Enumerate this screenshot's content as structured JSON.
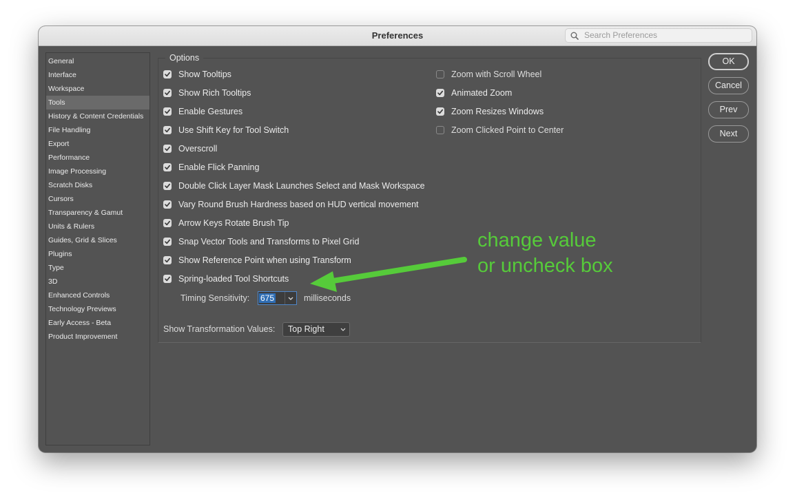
{
  "window": {
    "title": "Preferences"
  },
  "search": {
    "placeholder": "Search Preferences",
    "icon": "search-icon"
  },
  "sidebar": {
    "selected": "Tools",
    "items": [
      "General",
      "Interface",
      "Workspace",
      "Tools",
      "History & Content Credentials",
      "File Handling",
      "Export",
      "Performance",
      "Image Processing",
      "Scratch Disks",
      "Cursors",
      "Transparency & Gamut",
      "Units & Rulers",
      "Guides, Grid & Slices",
      "Plugins",
      "Type",
      "3D",
      "Enhanced Controls",
      "Technology Previews",
      "Early Access - Beta",
      "Product Improvement"
    ]
  },
  "options": {
    "legend": "Options",
    "left": [
      {
        "label": "Show Tooltips",
        "checked": true
      },
      {
        "label": "Show Rich Tooltips",
        "checked": true
      },
      {
        "label": "Enable Gestures",
        "checked": true
      },
      {
        "label": "Use Shift Key for Tool Switch",
        "checked": true
      },
      {
        "label": "Overscroll",
        "checked": true
      },
      {
        "label": "Enable Flick Panning",
        "checked": true
      },
      {
        "label": "Double Click Layer Mask Launches Select and Mask Workspace",
        "checked": true
      },
      {
        "label": "Vary Round Brush Hardness based on HUD vertical movement",
        "checked": true
      },
      {
        "label": "Arrow Keys Rotate Brush Tip",
        "checked": true
      },
      {
        "label": "Snap Vector Tools and Transforms to Pixel Grid",
        "checked": true
      },
      {
        "label": "Show Reference Point when using Transform",
        "checked": true
      },
      {
        "label": "Spring-loaded Tool Shortcuts",
        "checked": true
      }
    ],
    "right": [
      {
        "label": "Zoom with Scroll Wheel",
        "checked": false
      },
      {
        "label": "Animated Zoom",
        "checked": true
      },
      {
        "label": "Zoom Resizes Windows",
        "checked": true
      },
      {
        "label": "Zoom Clicked Point to Center",
        "checked": false
      }
    ],
    "timing": {
      "label": "Timing Sensitivity:",
      "value": "675",
      "unit": "milliseconds"
    },
    "transform_values": {
      "label": "Show Transformation Values:",
      "value": "Top Right"
    }
  },
  "buttons": {
    "ok": "OK",
    "cancel": "Cancel",
    "prev": "Prev",
    "next": "Next"
  },
  "annotation": {
    "line1": "change value",
    "line2": "or uncheck box",
    "color": "#56cb3a"
  }
}
